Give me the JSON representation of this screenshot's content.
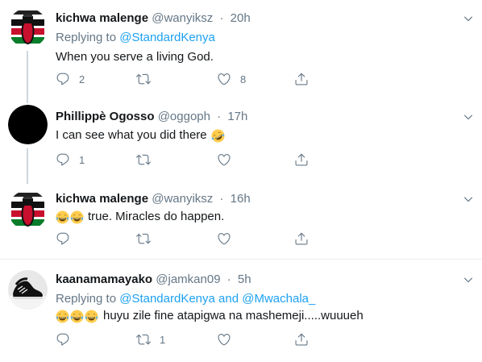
{
  "tweets": [
    {
      "name": "kichwa malenge",
      "handle": "@wanyiksz",
      "time": "20h",
      "replying_prefix": "Replying to",
      "replying_to": [
        "@StandardKenya"
      ],
      "text": "When you serve a living God.",
      "reply_count": "2",
      "retweet_count": "",
      "like_count": "8",
      "avatar_icon": "kenya-flag-fist-icon"
    },
    {
      "name": "Phillippè Ogosso",
      "handle": "@oggoph",
      "time": "17h",
      "text": "I can see what you did there",
      "text_emoji": [
        "rofl-emoji"
      ],
      "reply_count": "1",
      "retweet_count": "",
      "like_count": "",
      "avatar_icon": "black-circle-avatar"
    },
    {
      "name": "kichwa malenge",
      "handle": "@wanyiksz",
      "time": "16h",
      "text": "true. Miracles do happen.",
      "text_emoji": [
        "joy-emoji",
        "joy-emoji"
      ],
      "reply_count": "",
      "retweet_count": "",
      "like_count": "",
      "avatar_icon": "kenya-flag-fist-icon"
    },
    {
      "name": "kaanamamayako",
      "handle": "@jamkan09",
      "time": "5h",
      "replying_prefix": "Replying to",
      "replying_to": [
        "@StandardKenya",
        "@Mwachala_"
      ],
      "replying_joiner": "and",
      "text": "huyu zile fine atapigwa na mashemeji.....wuuueh",
      "text_emoji": [
        "joy-emoji",
        "joy-emoji",
        "joy-emoji"
      ],
      "reply_count": "",
      "retweet_count": "1",
      "like_count": "",
      "avatar_icon": "sneakers-photo-avatar"
    }
  ],
  "dot": "·",
  "colors": {
    "text": "#14171a",
    "secondary": "#657786",
    "link": "#1da1f2",
    "divider": "#e6ecf0",
    "thread_line": "#ccd6dd"
  }
}
